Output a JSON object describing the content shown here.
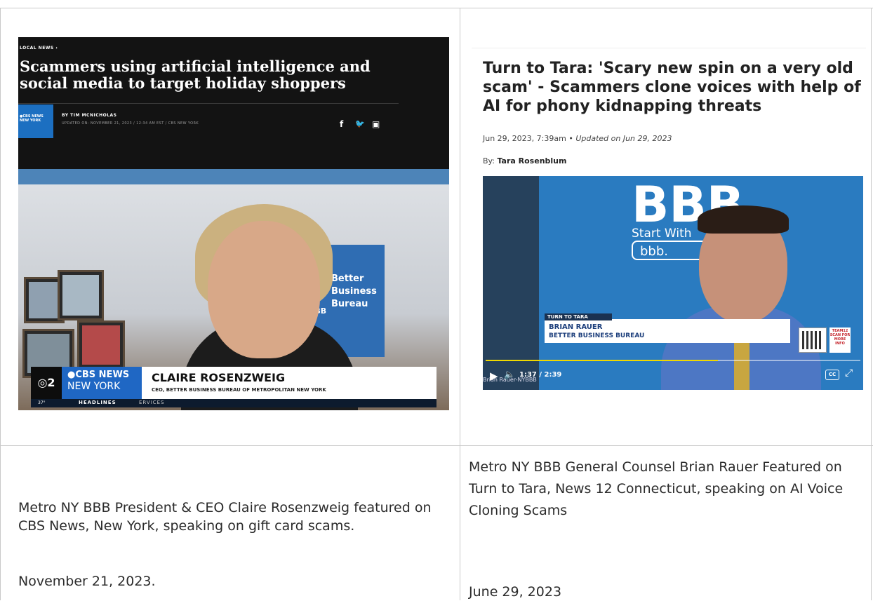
{
  "left_item": {
    "kicker": "LOCAL NEWS ›",
    "headline": "Scammers using artificial intelligence and social media to target holiday shoppers",
    "logo_text": "●CBS NEWS NEW YORK",
    "byline": "BY TIM MCNICHOLAS",
    "updated": "UPDATED ON: NOVEMBER 21, 2023 / 12:34 AM EST / CBS NEW YORK",
    "social": [
      "f",
      "🐦",
      "▣"
    ],
    "video": {
      "sign_text": "Better\nBusiness\nBureau",
      "sign_mark": "BBB",
      "channel_mark": "◎2",
      "brand_line1": "●CBS NEWS",
      "brand_line2": "NEW YORK",
      "person_name": "CLAIRE ROSENZWEIG",
      "person_title": "CEO, BETTER BUSINESS BUREAU OF METROPOLITAN NEW YORK",
      "ticker_temp": "37°",
      "ticker_headlines": "HEADLINES",
      "ticker_services": "ERVICES"
    },
    "caption": "Metro NY BBB President & CEO Claire Rosenzweig featured on CBS News, New York, speaking on gift card scams.",
    "date": "November 21, 2023."
  },
  "right_item": {
    "headline": "Turn to Tara: 'Scary new spin on a very old scam' - Scammers clone voices with help of AI for phony kidnapping threats",
    "date_line": "Jun 29, 2023, 7:39am",
    "updated_line": "Updated on Jun 29, 2023",
    "by_label": "By:",
    "author": "Tara Rosenblum",
    "video": {
      "wall_logo": "BBB",
      "wall_tagline": "Start With",
      "wall_url": "bbb.",
      "segment_tag": "TURN TO TARA",
      "person_name": "BRIAN RAUER",
      "person_org": "BETTER BUSINESS BUREAU",
      "qr_label": "TEAM12 SCAN FOR MORE INFO",
      "time_display": "1:37 / 2:39",
      "credit": "Brian Rauer-NYBBB",
      "cc_label": "CC",
      "progress": 0.62
    },
    "caption": "Metro NY BBB General Counsel Brian Rauer Featured on Turn to Tara, News 12 Connecticut, speaking on AI Voice Cloning Scams",
    "date": "June 29, 2023"
  },
  "colors": {
    "cbs_blue": "#1f67c4",
    "news12_blue": "#2a7bc0",
    "progress_yellow": "#f0d800",
    "border": "#c9c9c9"
  }
}
